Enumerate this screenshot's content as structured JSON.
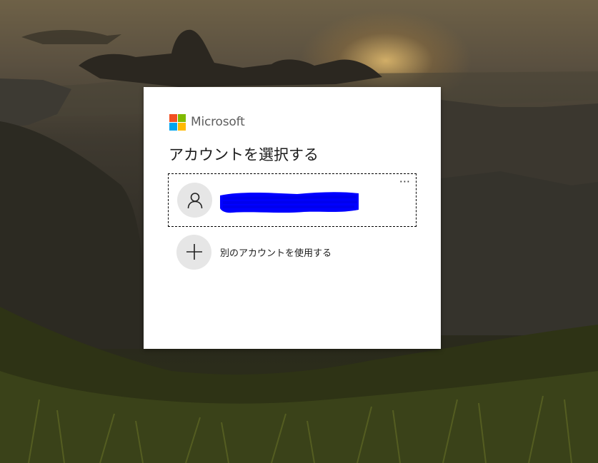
{
  "brand": {
    "name": "Microsoft",
    "logo_colors": [
      "#f25022",
      "#7fba00",
      "#00a4ef",
      "#ffb900"
    ]
  },
  "dialog": {
    "title": "アカウントを選択する"
  },
  "account_tile": {
    "more_options_label": "···",
    "avatar_icon": "person-icon",
    "name_redacted": true,
    "redaction_color": "#0000ff"
  },
  "other_account": {
    "icon": "plus-icon",
    "label": "別のアカウントを使用する"
  }
}
